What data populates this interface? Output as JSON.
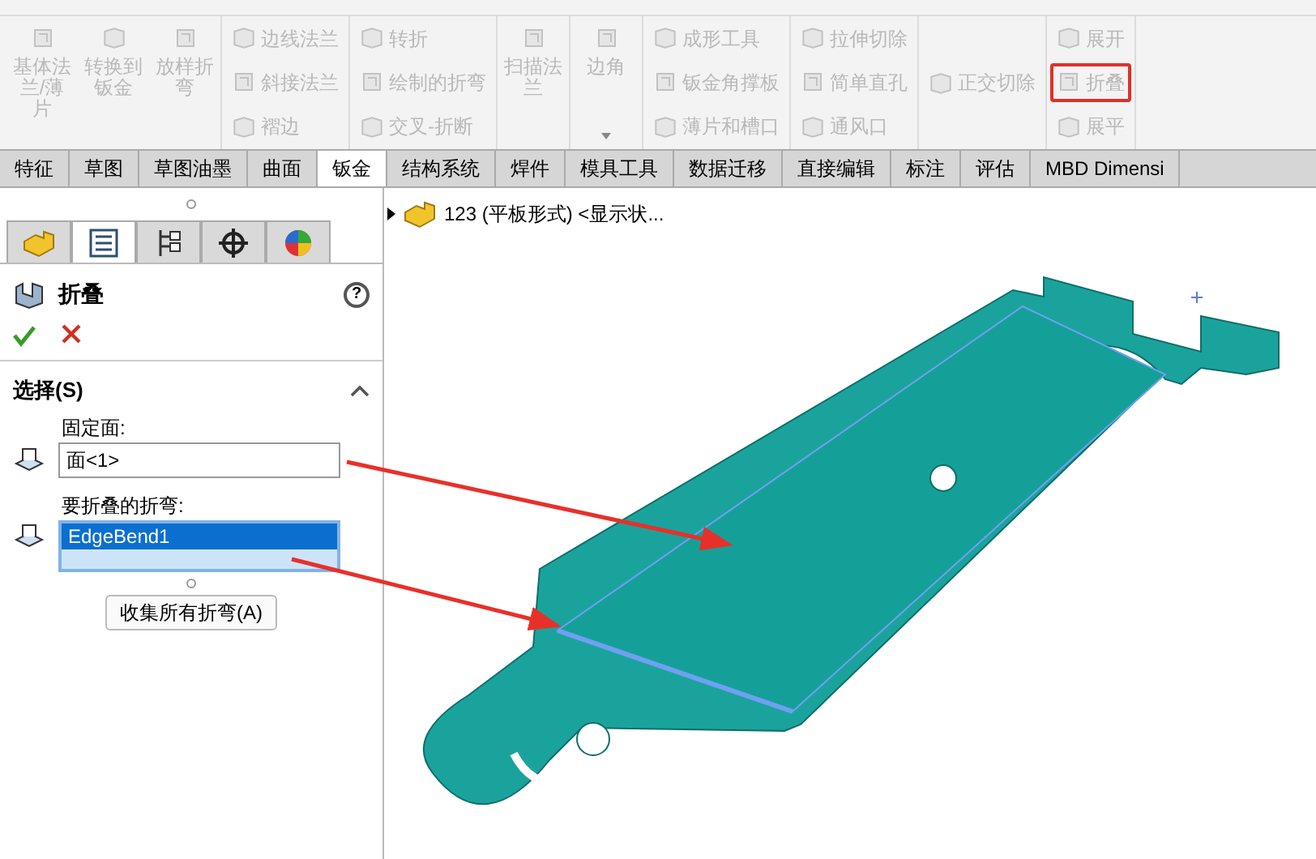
{
  "ribbon": {
    "groups": [
      {
        "kind": "large",
        "items": [
          {
            "label": "基体法兰/薄片",
            "highlighted": false
          },
          {
            "label": "转换到钣金",
            "highlighted": false
          },
          {
            "label": "放样折弯",
            "highlighted": false
          }
        ]
      },
      {
        "kind": "column",
        "items": [
          {
            "label": "边线法兰",
            "highlighted": false
          },
          {
            "label": "斜接法兰",
            "highlighted": false
          },
          {
            "label": "褶边",
            "highlighted": false
          }
        ]
      },
      {
        "kind": "column",
        "items": [
          {
            "label": "转折",
            "highlighted": false
          },
          {
            "label": "绘制的折弯",
            "highlighted": false
          },
          {
            "label": "交叉-折断",
            "highlighted": false
          }
        ]
      },
      {
        "kind": "large",
        "items": [
          {
            "label": "扫描法兰",
            "highlighted": false
          }
        ]
      },
      {
        "kind": "large",
        "items": [
          {
            "label": "边角",
            "highlighted": false,
            "dropdown": true
          }
        ]
      },
      {
        "kind": "column",
        "items": [
          {
            "label": "成形工具",
            "highlighted": false
          },
          {
            "label": "钣金角撑板",
            "highlighted": false
          },
          {
            "label": "薄片和槽口",
            "highlighted": false
          }
        ]
      },
      {
        "kind": "column",
        "items": [
          {
            "label": "拉伸切除",
            "highlighted": false
          },
          {
            "label": "简单直孔",
            "highlighted": false
          },
          {
            "label": "通风口",
            "highlighted": false
          }
        ]
      },
      {
        "kind": "column",
        "items": [
          {
            "label": "正交切除",
            "highlighted": false
          }
        ]
      },
      {
        "kind": "column",
        "items": [
          {
            "label": "展开",
            "highlighted": false
          },
          {
            "label": "折叠",
            "highlighted": true
          },
          {
            "label": "展平",
            "highlighted": false
          }
        ]
      }
    ]
  },
  "tabs": [
    {
      "label": "特征",
      "selected": false
    },
    {
      "label": "草图",
      "selected": false
    },
    {
      "label": "草图油墨",
      "selected": false
    },
    {
      "label": "曲面",
      "selected": false
    },
    {
      "label": "钣金",
      "selected": true
    },
    {
      "label": "结构系统",
      "selected": false
    },
    {
      "label": "焊件",
      "selected": false
    },
    {
      "label": "模具工具",
      "selected": false
    },
    {
      "label": "数据迁移",
      "selected": false
    },
    {
      "label": "直接编辑",
      "selected": false
    },
    {
      "label": "标注",
      "selected": false
    },
    {
      "label": "评估",
      "selected": false
    },
    {
      "label": "MBD Dimensi",
      "selected": false
    }
  ],
  "panel": {
    "tabs": [
      {
        "kind": "part",
        "selected": false
      },
      {
        "kind": "property",
        "selected": true
      },
      {
        "kind": "config",
        "selected": false
      },
      {
        "kind": "target",
        "selected": false
      },
      {
        "kind": "appearance",
        "selected": false
      }
    ],
    "title": "折叠",
    "help": "?",
    "section": {
      "title": "选择(S)",
      "expanded": true,
      "fixed_face": {
        "label": "固定面:",
        "value": "面<1>"
      },
      "bends": {
        "label": "要折叠的折弯:",
        "items": [
          {
            "label": "EdgeBend1",
            "selected": true
          }
        ]
      },
      "button": "收集所有折弯(A)"
    }
  },
  "tree": {
    "label": "123 (平板形式) <显示状..."
  }
}
